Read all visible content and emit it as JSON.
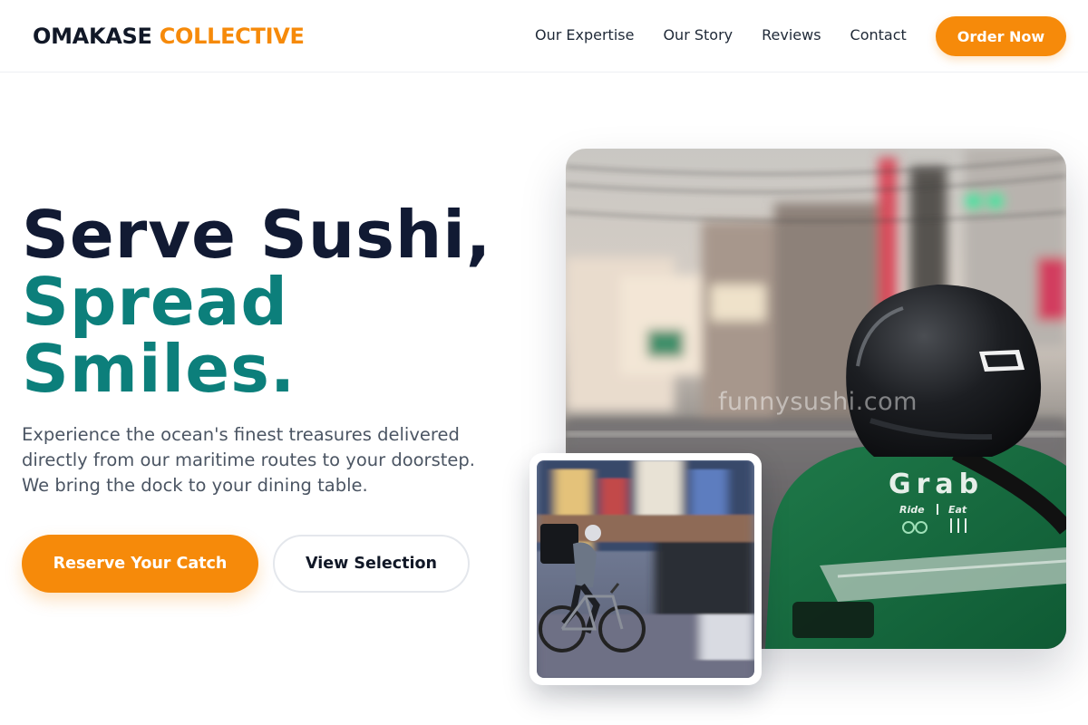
{
  "brand": {
    "part1": "OMAKASE",
    "part2": "COLLECTIVE",
    "accent": "#f68a0a"
  },
  "nav": {
    "items": [
      {
        "label": "Our Expertise"
      },
      {
        "label": "Our Story"
      },
      {
        "label": "Reviews"
      },
      {
        "label": "Contact"
      }
    ]
  },
  "header": {
    "cta_label": "Order Now"
  },
  "hero": {
    "headline_line1": "Serve Sushi,",
    "headline_line2": "Spread",
    "headline_line3": "Smiles.",
    "subtext": "Experience the ocean's finest treasures delivered directly from our maritime routes to your doorstep. We bring the dock to your dining table.",
    "primary_cta": "Reserve Your Catch",
    "secondary_cta": "View Selection",
    "headline_color": "#111a33",
    "highlight_color": "#0c7f7b"
  },
  "images": {
    "main_alt": "Delivery rider in green jacket and black helmet on a city street",
    "main_watermark": "funnysushi.com",
    "main_jacket_text": {
      "brand": "Grab",
      "ride": "Ride",
      "eat": "Eat"
    },
    "inset_alt": "Cyclist with delivery backpack riding through busy traffic"
  }
}
